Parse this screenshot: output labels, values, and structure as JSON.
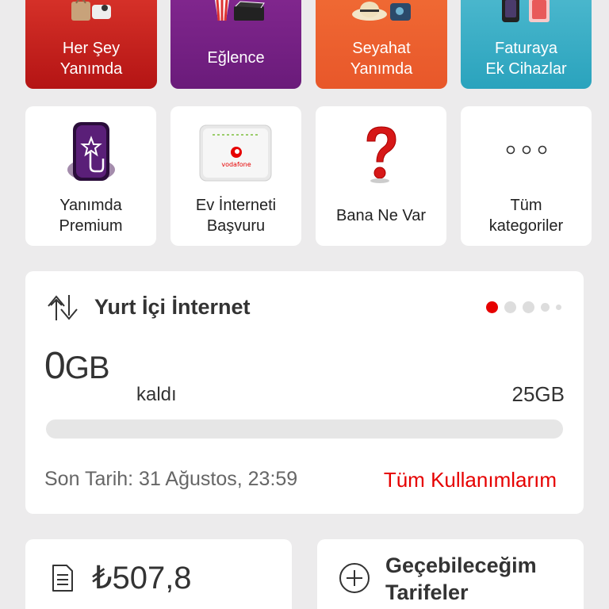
{
  "category_tiles": [
    {
      "label": "Her Şey\nYanımda",
      "icon": "shopping-bag-icon",
      "color": "#c8231f"
    },
    {
      "label": "Eğlence",
      "icon": "popcorn-clapper-icon",
      "color": "#7a2188"
    },
    {
      "label": "Seyahat\nYanımda",
      "icon": "travel-hat-icon",
      "color": "#ed6230"
    },
    {
      "label": "Faturaya\nEk Cihazlar",
      "icon": "devices-icon",
      "color": "#3aafc8"
    }
  ],
  "service_tiles": [
    {
      "label": "Yanımda\nPremium",
      "icon": "premium-phone-icon"
    },
    {
      "label": "Ev İnterneti\nBaşvuru",
      "icon": "modem-icon"
    },
    {
      "label": "Bana Ne Var",
      "icon": "question-mark-icon"
    },
    {
      "label": "Tüm\nkategoriler",
      "icon": "more-dots-icon"
    }
  ],
  "internet_card": {
    "title": "Yurt İçi İnternet",
    "remaining_value": "0",
    "remaining_unit": "GB",
    "remaining_label": "kaldı",
    "total": "25GB",
    "usage_fraction": 0,
    "deadline": "Son Tarih: 31 Ağustos, 23:59",
    "all_usage_link": "Tüm Kullanımlarım",
    "pager_active_index": 0,
    "pager_count": 5
  },
  "balance_card": {
    "amount": "₺507,8",
    "icon": "bill-document-icon"
  },
  "tariffs_card": {
    "label": "Geçebileceğim\nTarifeler",
    "icon": "add-circle-icon"
  },
  "colors": {
    "accent": "#e60000"
  }
}
